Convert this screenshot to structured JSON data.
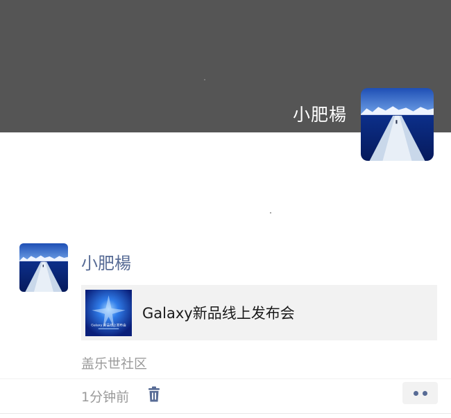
{
  "cover": {
    "user_name": "小肥楊"
  },
  "post": {
    "author_name": "小肥楊",
    "link_card": {
      "title": "Galaxy新品线上发布会",
      "thumbnail_caption": "Galaxy 新品线上发布会"
    },
    "source": "盖乐世社区",
    "time": "1分钟前",
    "icons": {
      "delete": "trash-icon",
      "more": "more-icon"
    }
  },
  "colors": {
    "cover_background": "#555555",
    "author_name": "#576b95",
    "meta_text": "#9a9a9a",
    "card_background": "#f2f2f2"
  }
}
